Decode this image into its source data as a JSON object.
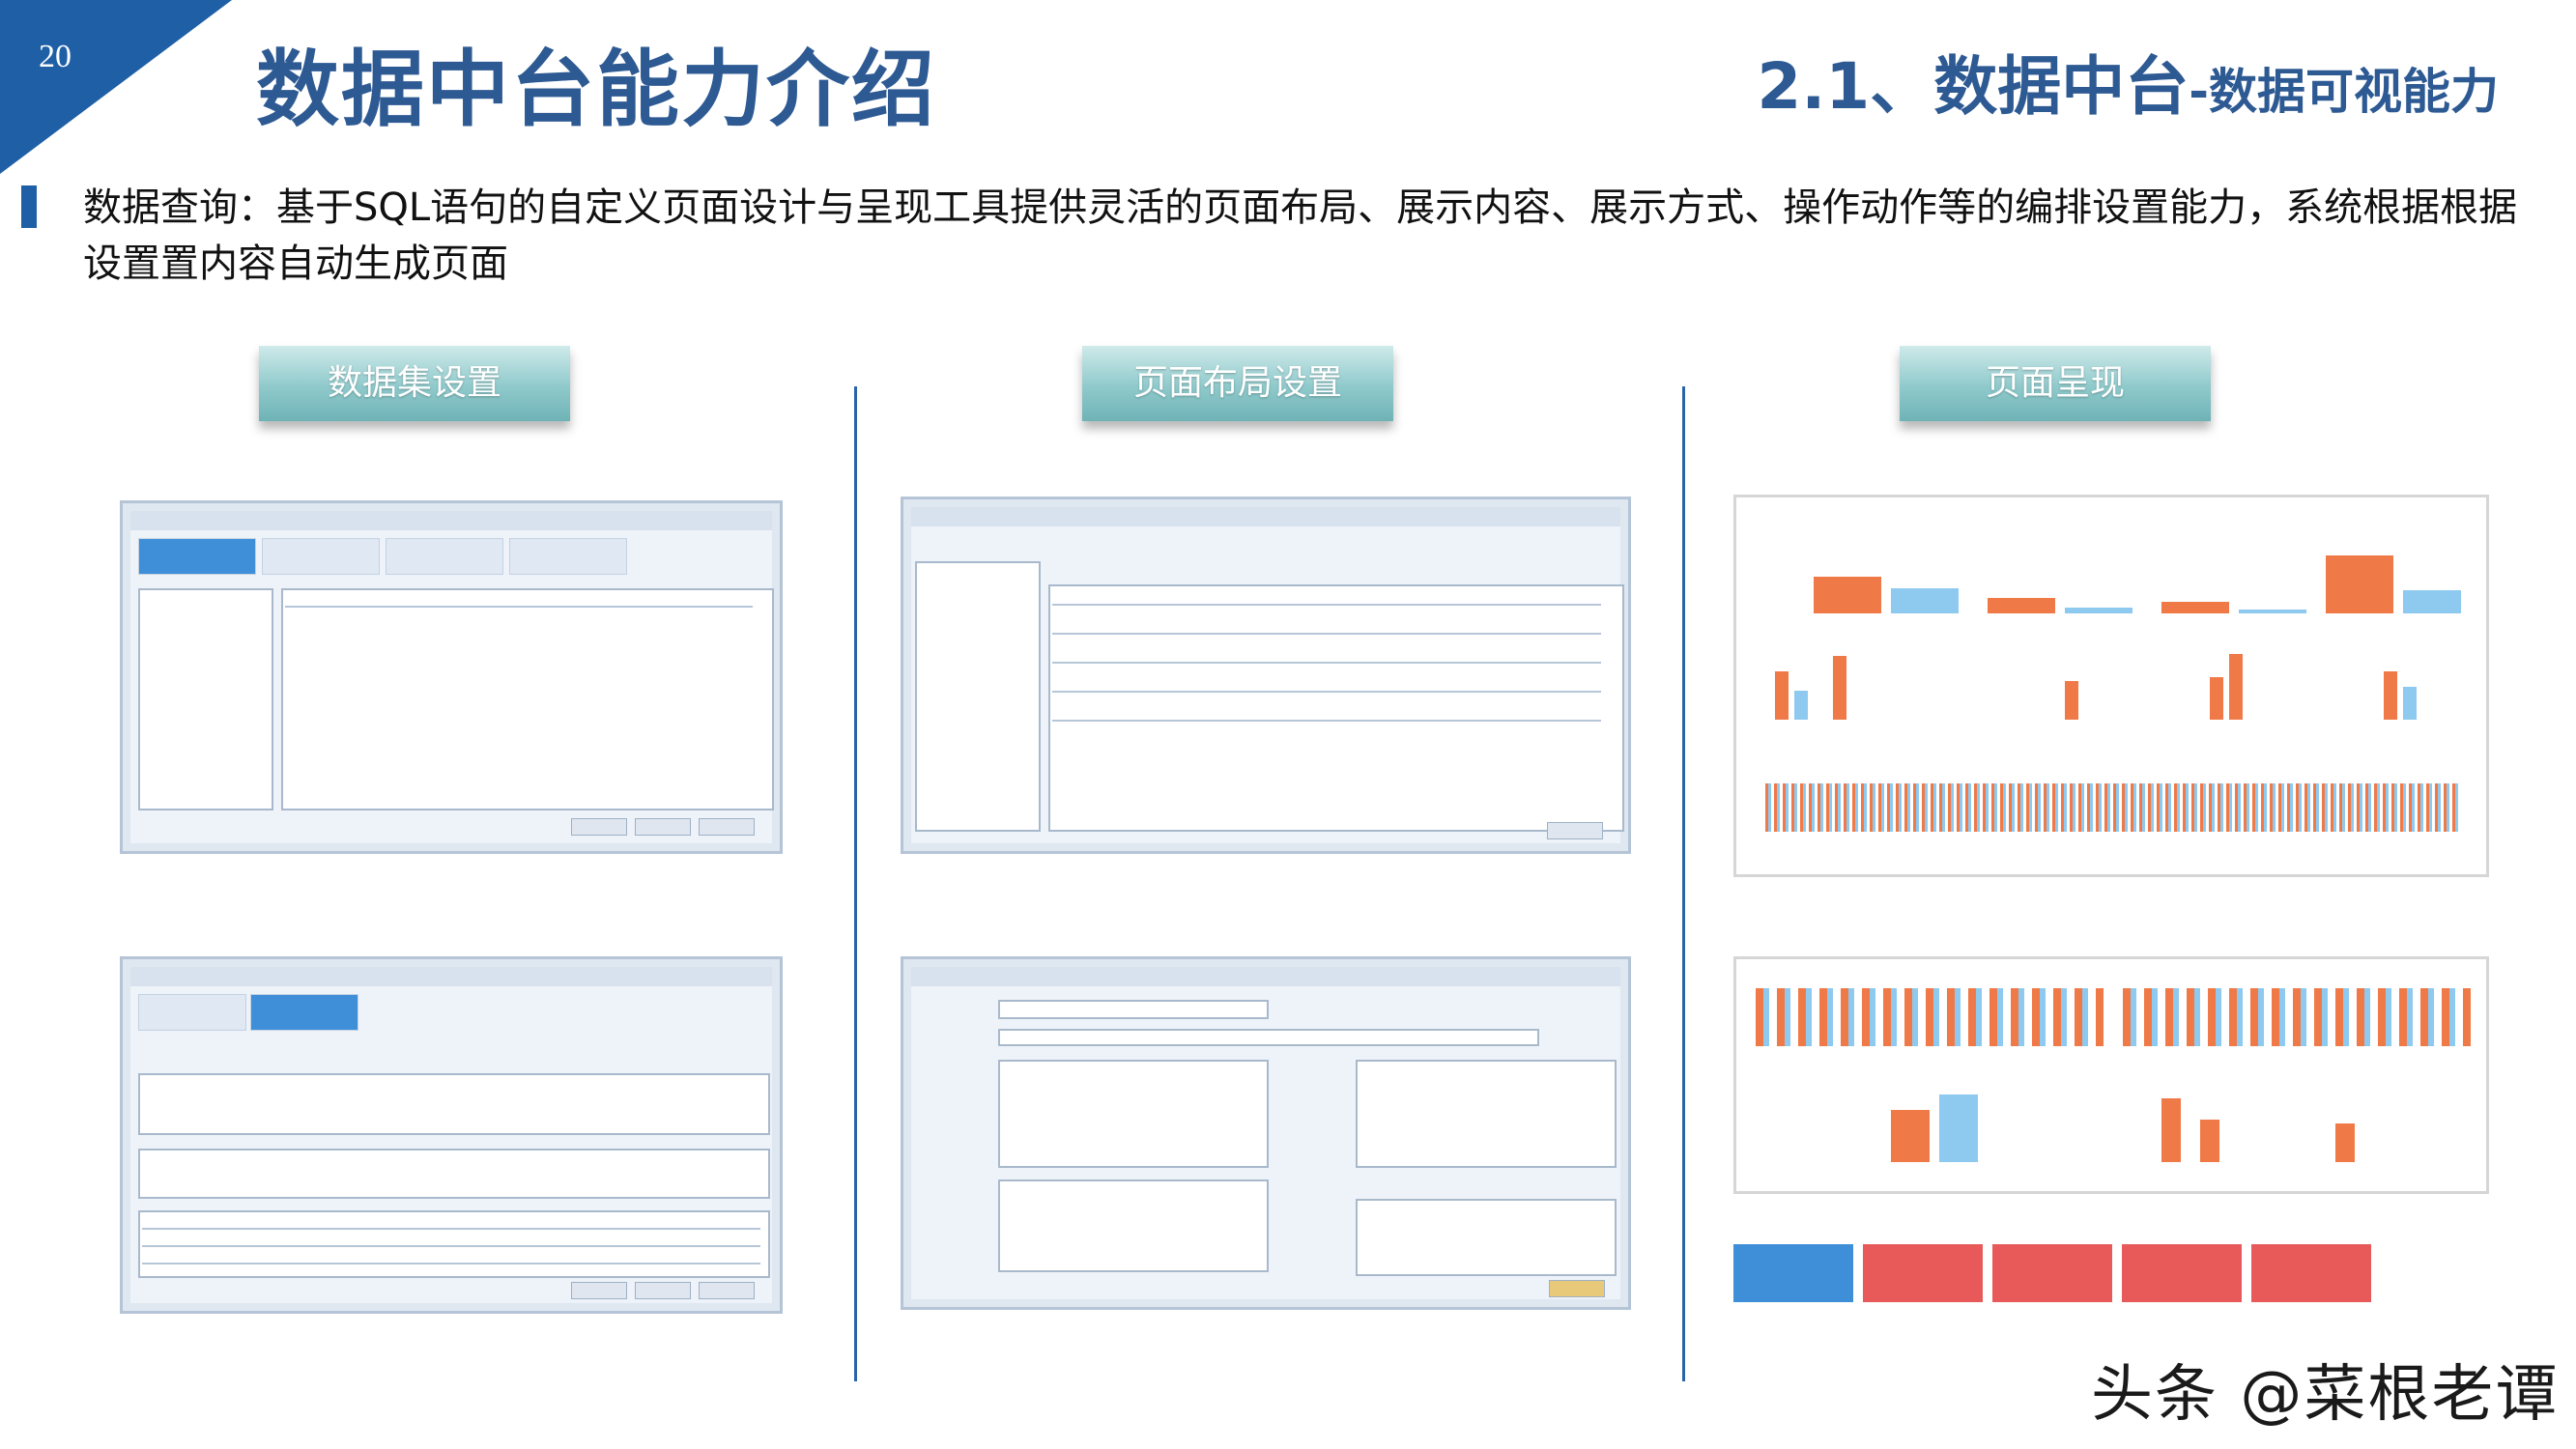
{
  "slide": {
    "page_number": "20",
    "title": "数据中台能力介绍",
    "section_prefix": "2.1、数据中台",
    "section_suffix": "-数据可视能力",
    "description": "数据查询：基于SQL语句的自定义页面设计与呈现工具提供灵活的页面布局、展示内容、展示方式、操作动作等的编排设置能力，系统根据根据设置置内容自动生成页面"
  },
  "columns": [
    {
      "label": "数据集设置"
    },
    {
      "label": "页面布局设置"
    },
    {
      "label": "页面呈现"
    }
  ],
  "watermark": "头条 @菜根老谭",
  "colors": {
    "accent": "#1e5fa6",
    "title": "#2e5a93",
    "button": "#8fc9cb",
    "bar_orange": "#f07a47",
    "bar_blue": "#8ec9f0",
    "card_red": "#e85a5a",
    "card_blue": "#3e8fd8"
  }
}
